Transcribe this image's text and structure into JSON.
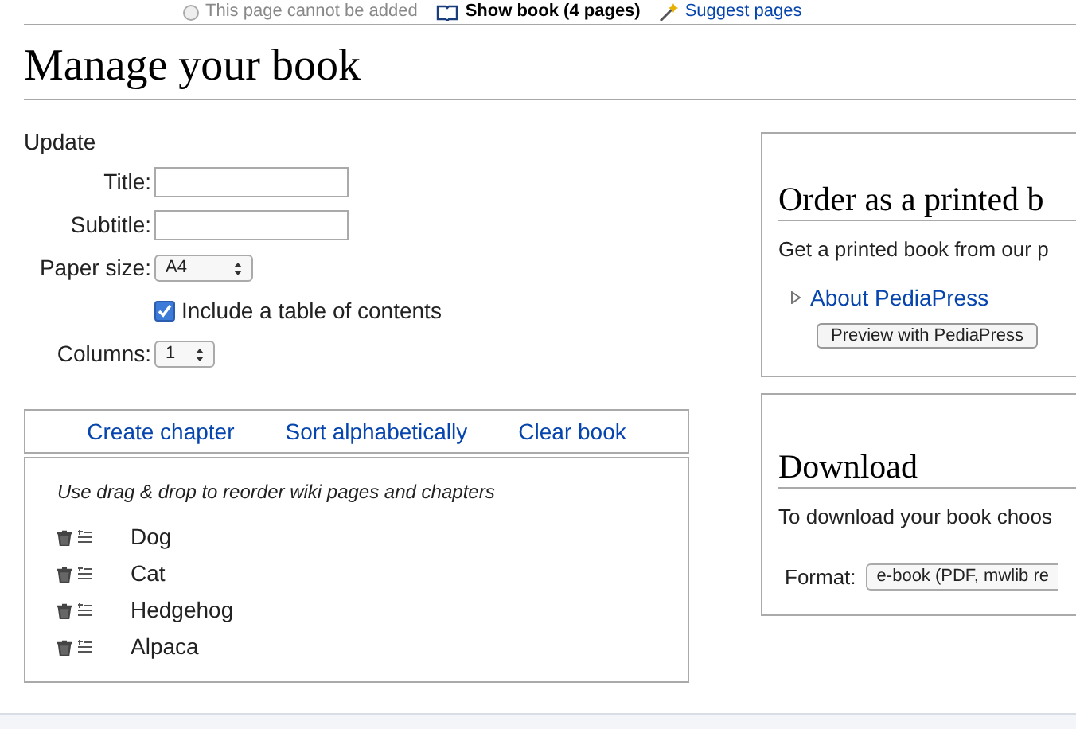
{
  "top_bar": {
    "add_status": "This page cannot be added",
    "show_book": "Show book (4 pages)",
    "suggest": "Suggest pages"
  },
  "heading": "Manage your book",
  "update": {
    "label": "Update",
    "title_label": "Title:",
    "subtitle_label": "Subtitle:",
    "paper_label": "Paper size:",
    "paper_value": "A4",
    "toc_label": "Include a table of contents",
    "toc_checked": true,
    "columns_label": "Columns:",
    "columns_value": "1"
  },
  "actions": [
    "Create chapter",
    "Sort alphabetically",
    "Clear book"
  ],
  "list": {
    "hint": "Use drag & drop to reorder wiki pages and chapters",
    "items": [
      "Dog",
      "Cat",
      "Hedgehog",
      "Alpaca"
    ]
  },
  "order": {
    "heading": "Order as a printed b",
    "text": "Get a printed book from our p",
    "link": "About PediaPress",
    "button": "Preview with PediaPress"
  },
  "download": {
    "heading": "Download",
    "text": "To download your book choos",
    "format_label": "Format:",
    "format_value": "e-book (PDF, mwlib re"
  }
}
